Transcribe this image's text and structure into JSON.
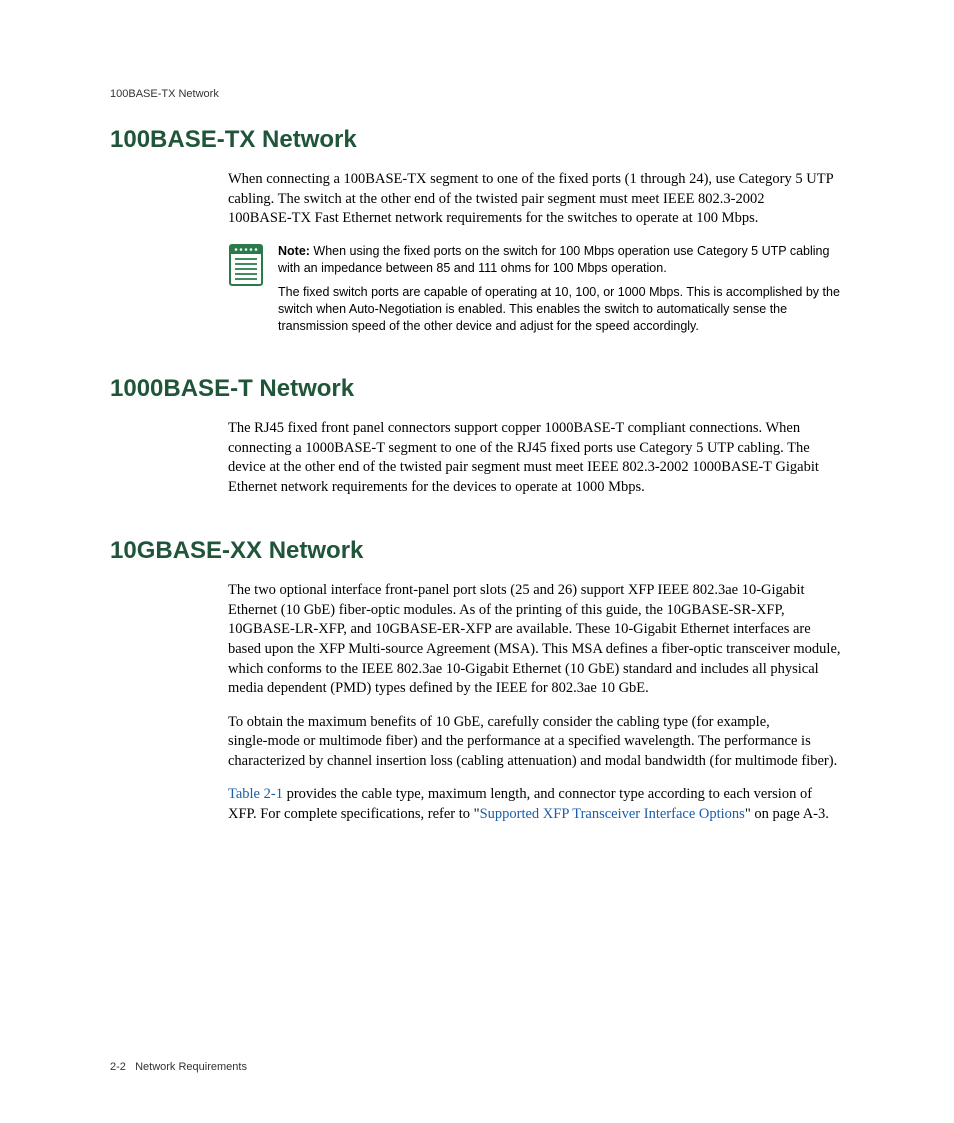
{
  "header": "100BASE-TX Network",
  "sections": {
    "s1": {
      "title": "100BASE-TX Network",
      "p1": "When connecting a 100BASE‑TX segment to one of the fixed ports (1 through 24), use Category 5 UTP cabling. The switch at the other end of the twisted pair segment must meet IEEE 802.3‑2002 100BASE‑TX Fast Ethernet network requirements for the switches to operate at 100 Mbps.",
      "note_label": "Note:",
      "note1": " When using the fixed ports on the switch for 100 Mbps operation use Category 5 UTP cabling with an impedance between 85 and 111 ohms for 100 Mbps operation.",
      "note2": "The fixed switch ports are capable of operating at 10, 100, or 1000 Mbps. This is accomplished by the switch when Auto-Negotiation is enabled. This enables the switch to automatically sense the transmission speed of the other device and adjust for the speed accordingly."
    },
    "s2": {
      "title": "1000BASE-T Network",
      "p1": "The RJ45 fixed front panel connectors support copper 1000BASE‑T compliant connections. When connecting a 1000BASE‑T segment to one of the RJ45 fixed ports use Category 5 UTP cabling. The device at the other end of the twisted pair segment must meet IEEE 802.3‑2002 1000BASE‑T Gigabit Ethernet network requirements for the devices to operate at 1000 Mbps."
    },
    "s3": {
      "title": "10GBASE-XX Network",
      "p1": "The two optional interface front‑panel port slots (25 and 26) support XFP IEEE 802.3ae 10‑Gigabit Ethernet (10 GbE) fiber‑optic modules. As of the printing of this guide, the 10GBASE‑SR‑XFP, 10GBASE‑LR‑XFP, and 10GBASE‑ER‑XFP  are available. These 10‑Gigabit Ethernet interfaces are based upon the XFP Multi‑source Agreement (MSA). This MSA defines a fiber‑optic transceiver module, which conforms to the IEEE 802.3ae 10‑Gigabit Ethernet (10 GbE) standard and includes all physical media dependent (PMD) types defined by the IEEE for 802.3ae 10 GbE.",
      "p2": "To obtain the maximum benefits of 10 GbE, carefully consider the cabling type (for example, single‑mode or multimode fiber) and the performance at a specified wavelength. The performance is characterized by channel insertion loss (cabling attenuation) and modal bandwidth (for multimode fiber).",
      "p3_link1": "Table 2‑1",
      "p3_mid": " provides the cable type, maximum length, and connector type according to each version of XFP. For complete specifications, refer to \"",
      "p3_link2": "Supported XFP Transceiver Interface Options",
      "p3_end": "\" on page A‑3."
    }
  },
  "footer": {
    "page": "2-2",
    "label": "Network Requirements"
  }
}
